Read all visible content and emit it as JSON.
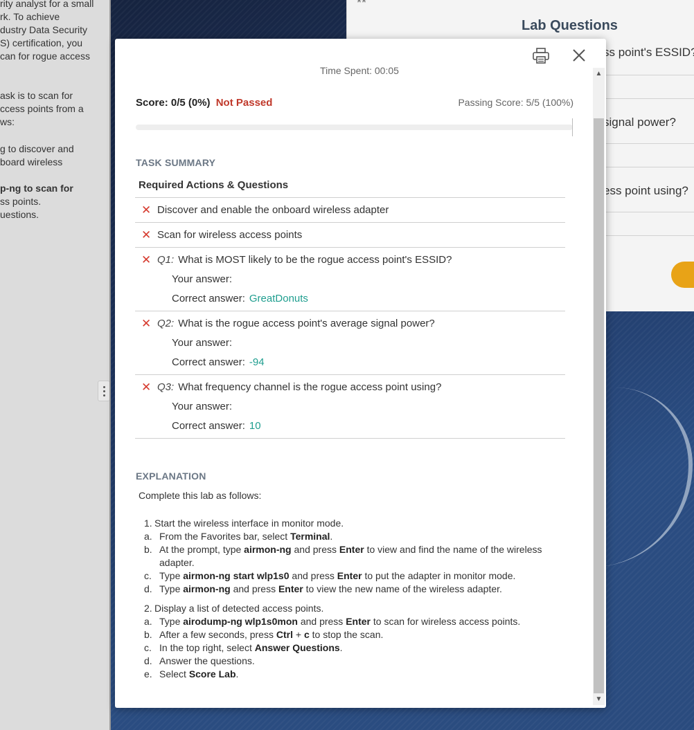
{
  "left_pane": {
    "lines": [
      "rity analyst for a small",
      "rk. To achieve",
      "dustry Data Security",
      "S) certification, you",
      "can for rogue access",
      "ask is to scan for",
      "ccess points from a",
      "ws:",
      "g to discover and",
      "board wireless",
      "p-ng to scan for",
      "ss points.",
      "uestions."
    ]
  },
  "lab_panel": {
    "top_mark": "**",
    "title": "Lab Questions",
    "questions": [
      "ss point's ESSID?",
      "signal power?",
      "ess point using?"
    ]
  },
  "modal": {
    "time_spent": "Time Spent: 00:05",
    "score_text": "Score: 0/5 (0%)",
    "status": "Not Passed",
    "passing_score": "Passing Score: 5/5 (100%)",
    "progress_percent": 0,
    "task_summary_label": "TASK SUMMARY",
    "table_header": "Required Actions & Questions",
    "tasks": [
      {
        "text": "Discover and enable the onboard wireless adapter"
      },
      {
        "text": "Scan for wireless access points"
      }
    ],
    "questions": [
      {
        "tag": "Q1:",
        "text": "What is MOST likely to be the rogue access point's ESSID?",
        "your_answer_label": "Your answer:",
        "your_answer": "",
        "correct_answer_label": "Correct answer:",
        "correct_answer": "GreatDonuts"
      },
      {
        "tag": "Q2:",
        "text": "What is the rogue access point's average signal power?",
        "your_answer_label": "Your answer:",
        "your_answer": "",
        "correct_answer_label": "Correct answer:",
        "correct_answer": "-94"
      },
      {
        "tag": "Q3:",
        "text": "What frequency channel is the rogue access point using?",
        "your_answer_label": "Your answer:",
        "your_answer": "",
        "correct_answer_label": "Correct answer:",
        "correct_answer": "10"
      }
    ],
    "explanation_label": "EXPLANATION",
    "explanation_intro": "Complete this lab as follows:"
  }
}
